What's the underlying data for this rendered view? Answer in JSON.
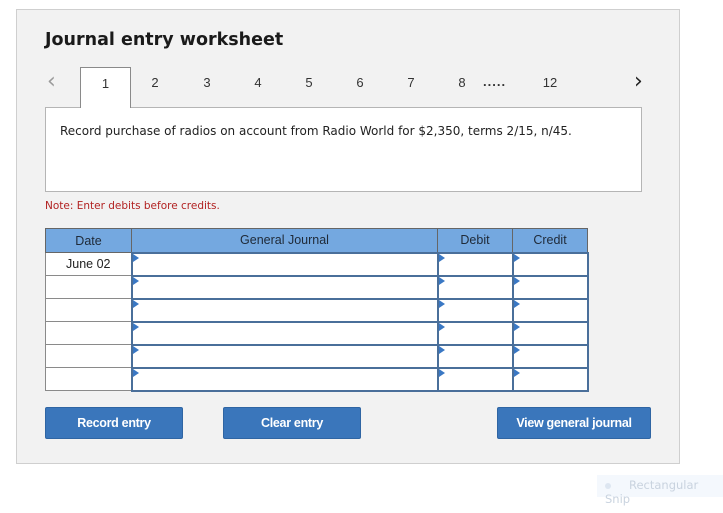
{
  "worksheet": {
    "title": "Journal entry worksheet",
    "tabs": [
      {
        "label": "1",
        "active": true
      },
      {
        "label": "2"
      },
      {
        "label": "3"
      },
      {
        "label": "4"
      },
      {
        "label": "5"
      },
      {
        "label": "6"
      },
      {
        "label": "7"
      },
      {
        "label": "8"
      },
      {
        "label": "12"
      }
    ],
    "tabs_ellipsis": ".....",
    "prev_icon": "chevron-left-icon",
    "next_icon": "chevron-right-icon",
    "question": "Record purchase of radios on account from Radio World for $2,350, terms 2/15, n/45.",
    "note": "Note: Enter debits before credits."
  },
  "journal": {
    "headers": [
      "Date",
      "General Journal",
      "Debit",
      "Credit"
    ],
    "rows": [
      {
        "date": "June 02",
        "account": "",
        "debit": "",
        "credit": ""
      },
      {
        "date": "",
        "account": "",
        "debit": "",
        "credit": ""
      },
      {
        "date": "",
        "account": "",
        "debit": "",
        "credit": ""
      },
      {
        "date": "",
        "account": "",
        "debit": "",
        "credit": ""
      },
      {
        "date": "",
        "account": "",
        "debit": "",
        "credit": ""
      },
      {
        "date": "",
        "account": "",
        "debit": "",
        "credit": ""
      }
    ]
  },
  "buttons": {
    "record": "Record entry",
    "clear": "Clear entry",
    "view": "View general journal"
  },
  "overlay": {
    "snip_label": "Rectangular Snip"
  },
  "colors": {
    "header_bg": "#74a8e0",
    "button_bg": "#3a76bb",
    "note_text": "#b22222",
    "input_border": "#4a6f9a"
  }
}
